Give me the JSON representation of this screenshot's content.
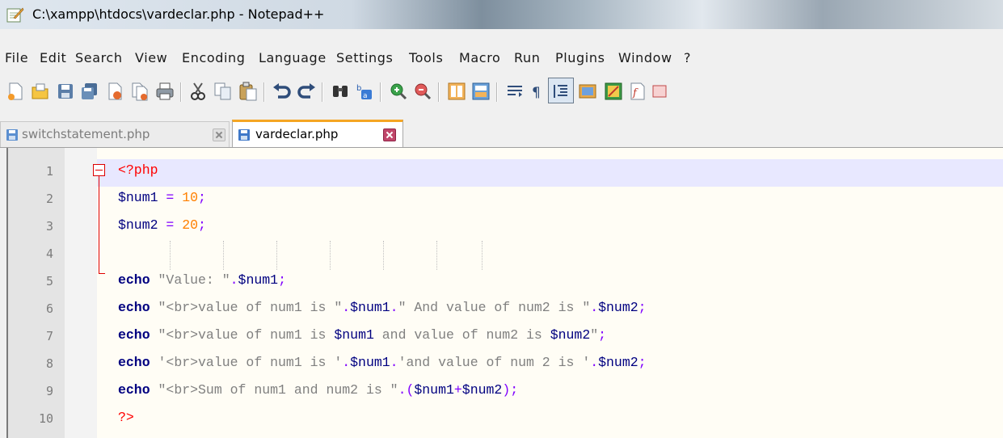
{
  "window": {
    "title": "C:\\xampp\\htdocs\\vardeclar.php - Notepad++",
    "app_icon": "notepadpp-icon"
  },
  "menu": [
    "File",
    "Edit",
    "Search",
    "View",
    "Encoding",
    "Language",
    "Settings",
    "Tools",
    "Macro",
    "Run",
    "Plugins",
    "Window",
    "?"
  ],
  "toolbar_icons": [
    "new-file-icon",
    "open-file-icon",
    "save-icon",
    "save-all-icon",
    "close-icon",
    "close-all-icon",
    "print-icon",
    "cut-icon",
    "copy-icon",
    "paste-icon",
    "undo-icon",
    "redo-icon",
    "find-icon",
    "replace-icon",
    "zoom-in-icon",
    "zoom-out-icon",
    "sync-vertical-icon",
    "sync-horizontal-icon",
    "word-wrap-icon",
    "show-all-chars-icon",
    "indent-guide-icon",
    "doc-map-icon",
    "function-list-icon",
    "macro-record-icon",
    "more-icon"
  ],
  "tabs": [
    {
      "label": "switchstatement.php",
      "active": false
    },
    {
      "label": "vardeclar.php",
      "active": true
    }
  ],
  "editor": {
    "line_numbers": [
      "1",
      "2",
      "3",
      "4",
      "5",
      "6",
      "7",
      "8",
      "9",
      "10"
    ],
    "lines": [
      {
        "tokens": [
          {
            "t": "<?php",
            "c": "t"
          }
        ]
      },
      {
        "tokens": [
          {
            "t": "$num1",
            "c": "v"
          },
          {
            "t": " = ",
            "c": "o"
          },
          {
            "t": "10",
            "c": "n"
          },
          {
            "t": ";",
            "c": "o"
          }
        ]
      },
      {
        "tokens": [
          {
            "t": "$num2",
            "c": "v"
          },
          {
            "t": " = ",
            "c": "o"
          },
          {
            "t": "20",
            "c": "n"
          },
          {
            "t": ";",
            "c": "o"
          }
        ]
      },
      {
        "tokens": []
      },
      {
        "tokens": [
          {
            "t": "echo",
            "c": "k"
          },
          {
            "t": " \"Value: \"",
            "c": "s"
          },
          {
            "t": ".",
            "c": "o"
          },
          {
            "t": "$num1",
            "c": "v"
          },
          {
            "t": ";",
            "c": "o"
          }
        ]
      },
      {
        "tokens": [
          {
            "t": "echo",
            "c": "k"
          },
          {
            "t": " \"<br>value of num1 is \"",
            "c": "s"
          },
          {
            "t": ".",
            "c": "o"
          },
          {
            "t": "$num1",
            "c": "v"
          },
          {
            "t": ".",
            "c": "o"
          },
          {
            "t": "\" And value of num2 is \"",
            "c": "s"
          },
          {
            "t": ".",
            "c": "o"
          },
          {
            "t": "$num2",
            "c": "v"
          },
          {
            "t": ";",
            "c": "o"
          }
        ]
      },
      {
        "tokens": [
          {
            "t": "echo",
            "c": "k"
          },
          {
            "t": " \"<br>value of num1 is ",
            "c": "s"
          },
          {
            "t": "$num1",
            "c": "v"
          },
          {
            "t": " and value of num2 is ",
            "c": "s"
          },
          {
            "t": "$num2",
            "c": "v"
          },
          {
            "t": "\"",
            "c": "s"
          },
          {
            "t": ";",
            "c": "o"
          }
        ]
      },
      {
        "tokens": [
          {
            "t": "echo",
            "c": "k"
          },
          {
            "t": " '<br>value of num1 is '",
            "c": "s"
          },
          {
            "t": ".",
            "c": "o"
          },
          {
            "t": "$num1",
            "c": "v"
          },
          {
            "t": ".",
            "c": "o"
          },
          {
            "t": "'and value of num 2 is '",
            "c": "s"
          },
          {
            "t": ".",
            "c": "o"
          },
          {
            "t": "$num2",
            "c": "v"
          },
          {
            "t": ";",
            "c": "o"
          }
        ]
      },
      {
        "tokens": [
          {
            "t": "echo",
            "c": "k"
          },
          {
            "t": " \"<br>Sum of num1 and num2 is \"",
            "c": "s"
          },
          {
            "t": ".(",
            "c": "o"
          },
          {
            "t": "$num1",
            "c": "v"
          },
          {
            "t": "+",
            "c": "o"
          },
          {
            "t": "$num2",
            "c": "v"
          },
          {
            "t": ");",
            "c": "o"
          }
        ]
      },
      {
        "tokens": [
          {
            "t": "?>",
            "c": "t"
          }
        ]
      }
    ]
  },
  "colors": {
    "keyword": "#000080",
    "number": "#ff8000",
    "operator": "#8000ff",
    "string": "#808080",
    "php_tag": "#ff0000",
    "active_tab_accent": "#f5a623",
    "current_line": "#e8e8ff"
  }
}
